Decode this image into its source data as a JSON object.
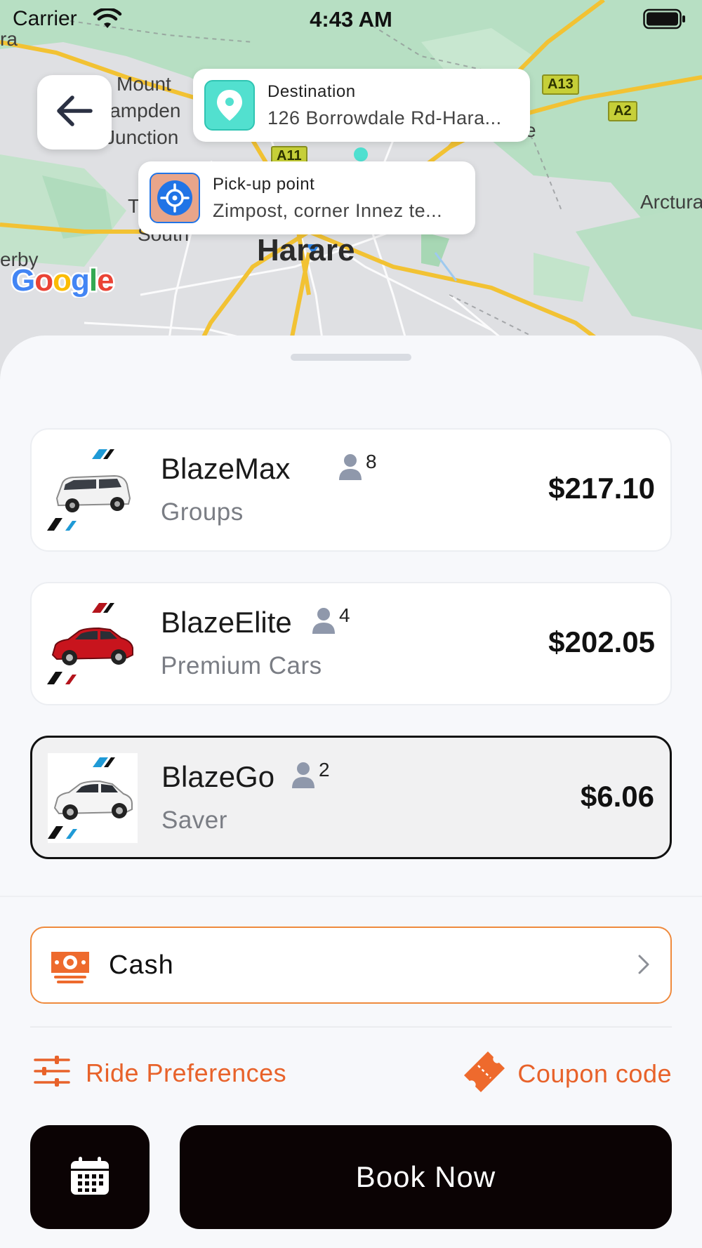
{
  "status_bar": {
    "carrier": "Carrier",
    "time": "4:43 AM"
  },
  "map": {
    "labels": {
      "city": "Harare",
      "mount": "Mount",
      "hampden": "lampden",
      "junction": "Junction",
      "south": "South",
      "arctur": "Arctura",
      "erby": "erby",
      "ra": "ra",
      "t": "T",
      "e": "e"
    },
    "shields": {
      "a13": "A13",
      "a2": "A2",
      "a11": "A11"
    },
    "attribution": "Google"
  },
  "destination": {
    "title": "Destination",
    "address": "126 Borrowdale Rd-Hara..."
  },
  "pickup": {
    "title": "Pick-up point",
    "address": "Zimpost, corner Innez te..."
  },
  "rides": [
    {
      "name": "BlazeMax",
      "capacity": "8",
      "category": "Groups",
      "price": "$217.10",
      "selected": false
    },
    {
      "name": "BlazeElite",
      "capacity": "4",
      "category": "Premium Cars",
      "price": "$202.05",
      "selected": false
    },
    {
      "name": "BlazeGo",
      "capacity": "2",
      "category": "Saver",
      "price": "$6.06",
      "selected": true
    }
  ],
  "payment": {
    "method": "Cash"
  },
  "actions": {
    "ride_preferences": "Ride Preferences",
    "coupon_code": "Coupon code",
    "book_now": "Book Now"
  },
  "colors": {
    "accent": "#e8622a",
    "accent_border": "#ef8a3d",
    "button_dark": "#0b0304",
    "destination_icon_bg": "#52e0cf",
    "pickup_icon_bg": "#e8a58a",
    "pickup_icon_fg": "#2174e6"
  },
  "icons": {
    "wifi": "wifi-icon",
    "battery": "battery-icon",
    "back": "arrow-left-icon",
    "destination": "map-pin-icon",
    "pickup": "crosshair-icon",
    "person": "person-icon",
    "cash": "cash-icon",
    "chevron": "chevron-right-icon",
    "preferences": "sliders-icon",
    "coupon": "ticket-icon",
    "calendar": "calendar-icon"
  }
}
